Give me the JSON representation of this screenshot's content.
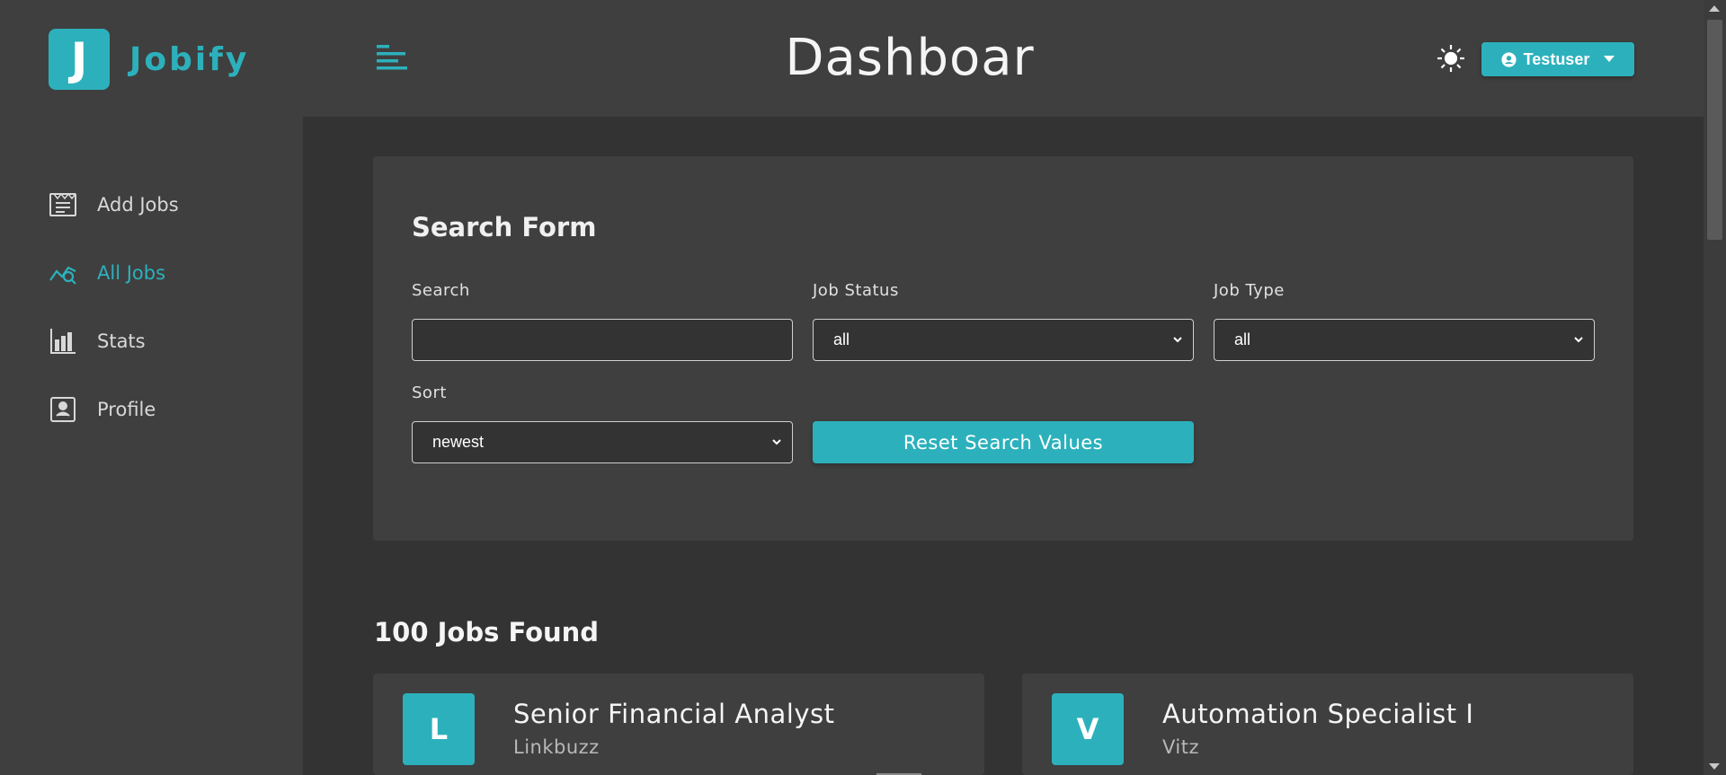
{
  "app": {
    "logo_letter": "J",
    "logo_text": "Jobify",
    "accent_color": "#2cb1bc"
  },
  "sidebar": {
    "items": [
      {
        "label": "Add Jobs",
        "icon": "add-jobs-icon",
        "active": false
      },
      {
        "label": "All Jobs",
        "icon": "all-jobs-icon",
        "active": true
      },
      {
        "label": "Stats",
        "icon": "stats-icon",
        "active": false
      },
      {
        "label": "Profile",
        "icon": "profile-icon",
        "active": false
      }
    ]
  },
  "header": {
    "title": "Dashboar",
    "user_name": "Testuser",
    "toggle_icon": "menu-toggle-icon",
    "theme_icon": "sun-icon"
  },
  "search_form": {
    "title": "Search Form",
    "search_label": "Search",
    "search_value": "",
    "status_label": "Job Status",
    "status_value": "all",
    "type_label": "Job Type",
    "type_value": "all",
    "sort_label": "Sort",
    "sort_value": "newest",
    "reset_label": "Reset Search Values"
  },
  "jobs": {
    "count_text": "100 Jobs Found",
    "items": [
      {
        "letter": "L",
        "title": "Senior Financial Analyst",
        "company": "Linkbuzz"
      },
      {
        "letter": "V",
        "title": "Automation Specialist I",
        "company": "Vitz"
      }
    ]
  }
}
